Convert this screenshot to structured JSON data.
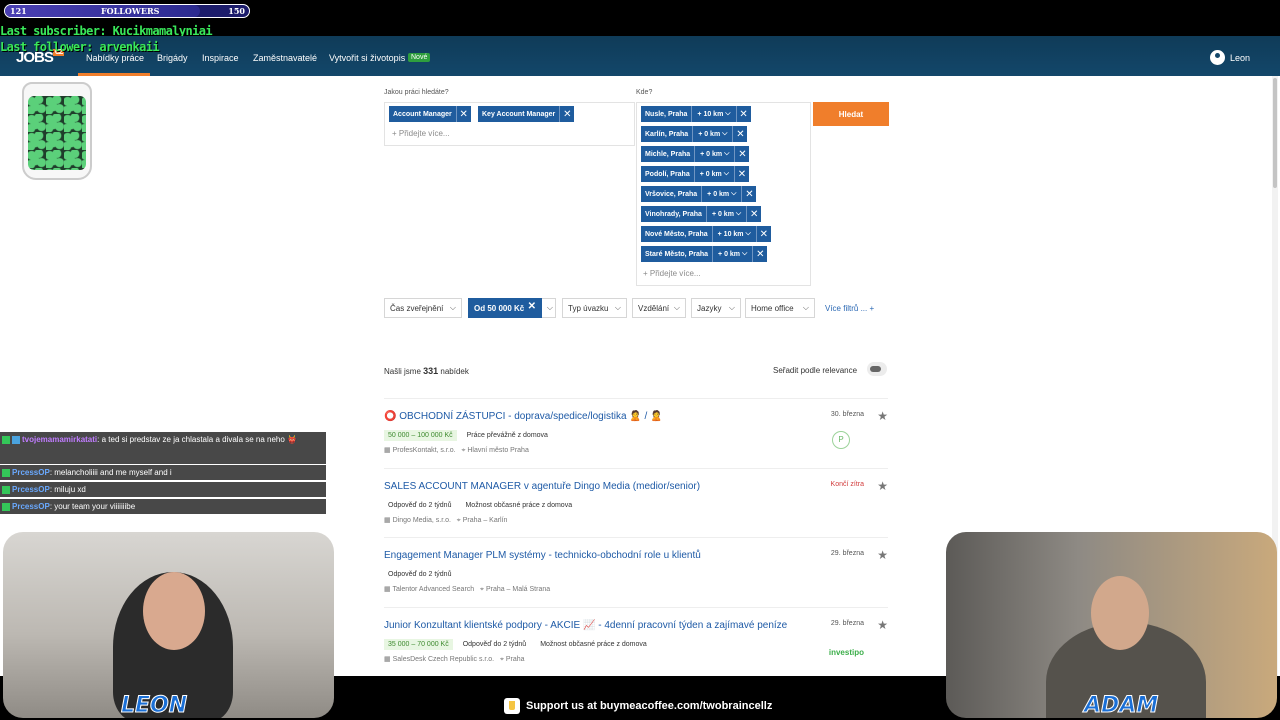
{
  "overlay": {
    "followers": {
      "label": "FOLLOWERS",
      "current": "121",
      "goal": "150",
      "progress": 0.8
    },
    "last_subscriber": "Last subscriber: Kucikmamalyniai",
    "last_follower": "Last follower: arvenkaii",
    "support_text": "Support us at buymeacoffee.com/twobraincellz"
  },
  "nav": {
    "logo": "JOBS",
    "logo_suffix": "CZ",
    "items": [
      "Nabídky práce",
      "Brigády",
      "Inspirace",
      "Zaměstnavatelé",
      "Vytvořit si životopis"
    ],
    "badge": "Nové",
    "user": "Leon"
  },
  "search": {
    "what_label": "Jakou práci hledáte?",
    "where_label": "Kde?",
    "what_chips": [
      "Account Manager",
      "Key Account Manager"
    ],
    "add_more": "+ Přidejte více...",
    "locations": [
      {
        "name": "Nusle, Praha",
        "radius": "+ 10 km"
      },
      {
        "name": "Karlín, Praha",
        "radius": "+ 0 km"
      },
      {
        "name": "Michle, Praha",
        "radius": "+ 0 km"
      },
      {
        "name": "Podolí, Praha",
        "radius": "+ 0 km"
      },
      {
        "name": "Vršovice, Praha",
        "radius": "+ 0 km"
      },
      {
        "name": "Vinohrady, Praha",
        "radius": "+ 0 km"
      },
      {
        "name": "Nové Město, Praha",
        "radius": "+ 10 km"
      },
      {
        "name": "Staré Město, Praha",
        "radius": "+ 0 km"
      }
    ],
    "button": "Hledat"
  },
  "filters": {
    "items": [
      "Čas zveřejnění",
      "Od 50 000 Kč",
      "Typ úvazku",
      "Vzdělání",
      "Jazyky",
      "Home office"
    ],
    "more": "Více filtrů ... +"
  },
  "results": {
    "prefix": "Našli jsme",
    "count": "331",
    "suffix": "nabídek",
    "sort_label": "Seřadit podle relevance"
  },
  "jobs": [
    {
      "title": "⭕ OBCHODNÍ ZÁSTUPCI - doprava/spedice/logistika 🙎 / 🙎",
      "date": "30. března",
      "salary": "50 000 – 100 000 Kč",
      "tags": [
        "Práce převážně z domova"
      ],
      "company": "ProfesKontakt, s.r.o.",
      "location": "Hlavní město Praha",
      "logo": "P"
    },
    {
      "title": "SALES ACCOUNT MANAGER v agentuře Dingo Media (medior/senior)",
      "date": "Končí zítra",
      "salary": "",
      "tags": [
        "Odpověď do 2 týdnů",
        "Možnost občasné práce z domova"
      ],
      "company": "Dingo Media, s.r.o.",
      "location": "Praha – Karlín",
      "logo": ""
    },
    {
      "title": "Engagement Manager PLM systémy - technicko-obchodní role u klientů",
      "date": "29. března",
      "salary": "",
      "tags": [
        "Odpověď do 2 týdnů"
      ],
      "company": "Talentor Advanced Search",
      "location": "Praha – Malá Strana",
      "logo": ""
    },
    {
      "title": "Junior Konzultant klientské podpory - AKCIE 📈 - 4denní pracovní týden a zajímavé peníze",
      "date": "29. března",
      "salary": "35 000 – 70 000 Kč",
      "tags": [
        "Odpověď do 2 týdnů",
        "Možnost občasné práce z domova"
      ],
      "company": "SalesDesk Czech Republic s.r.o.",
      "location": "Praha",
      "logo": "investipo"
    }
  ],
  "chat": [
    {
      "user": "tvojemamamirkatati",
      "text": ": a ted si predstav ze ja chlastala a divala se na neho 👹"
    },
    {
      "user": "PrcessOP",
      "text": ": melancholiiii and me myself and i"
    },
    {
      "user": "PrcessOP",
      "text": ": miluju xd"
    },
    {
      "user": "PrcessOP",
      "text": ": your team your viiiiiiibe"
    }
  ],
  "cams": {
    "left": "LEON",
    "right": "ADAM"
  },
  "colors": {
    "nav": "#13476a",
    "accent": "#f07e2b",
    "chip": "#1f5c9e",
    "link": "#1e5aa6"
  }
}
